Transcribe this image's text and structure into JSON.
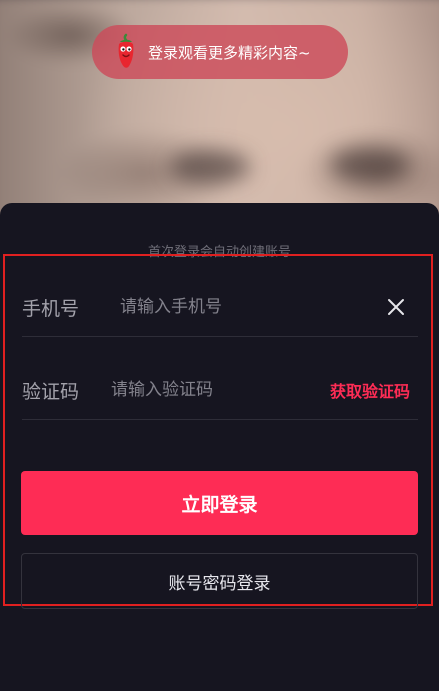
{
  "banner": {
    "text": "登录观看更多精彩内容~",
    "icon": "chili-mascot-icon"
  },
  "form": {
    "hint": "首次登录会自动创建账号",
    "phone": {
      "label": "手机号",
      "placeholder": "请输入手机号",
      "value": "",
      "clear_icon": "close-icon"
    },
    "code": {
      "label": "验证码",
      "placeholder": "请输入验证码",
      "value": "",
      "get_code_label": "获取验证码"
    },
    "login_button": "立即登录",
    "password_login_button": "账号密码登录"
  },
  "colors": {
    "accent": "#fe2c55",
    "background": "#161520",
    "highlight_border": "#e02020"
  }
}
